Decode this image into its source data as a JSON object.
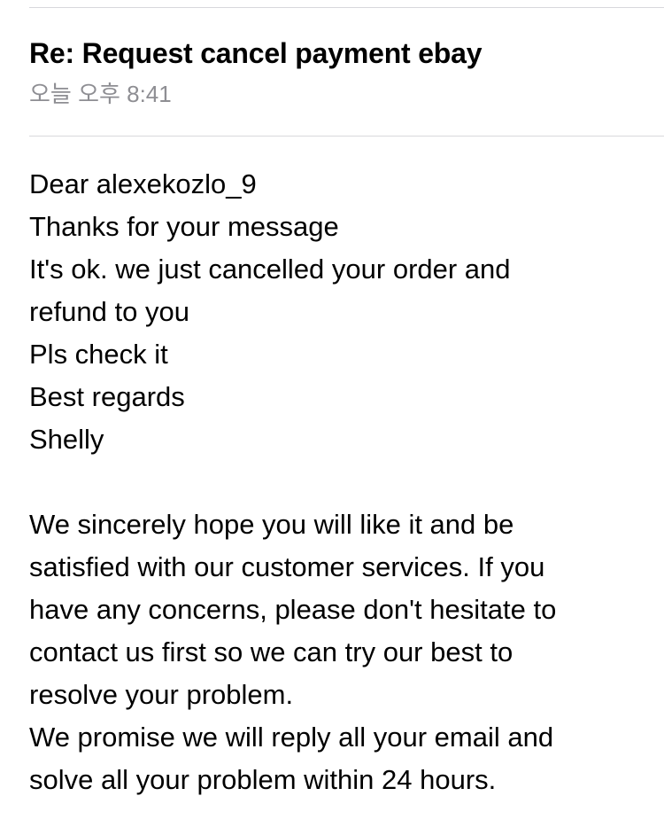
{
  "header": {
    "subject": "Re: Request cancel payment ebay",
    "time": "오늘 오후 8:41"
  },
  "body": {
    "greeting_lines": [
      "Dear alexekozlo_9",
      "Thanks for your message",
      "It's ok. we just cancelled your order and",
      "refund to you",
      "Pls check it",
      "Best regards",
      "Shelly"
    ],
    "footer_lines": [
      "We sincerely hope you will like it and be",
      "satisfied with our customer services. If you",
      "have any concerns, please don't hesitate to",
      "contact us first so we can try our best to",
      "resolve your problem.",
      "We promise we will reply all your email and",
      "solve all your problem  within 24 hours."
    ]
  }
}
